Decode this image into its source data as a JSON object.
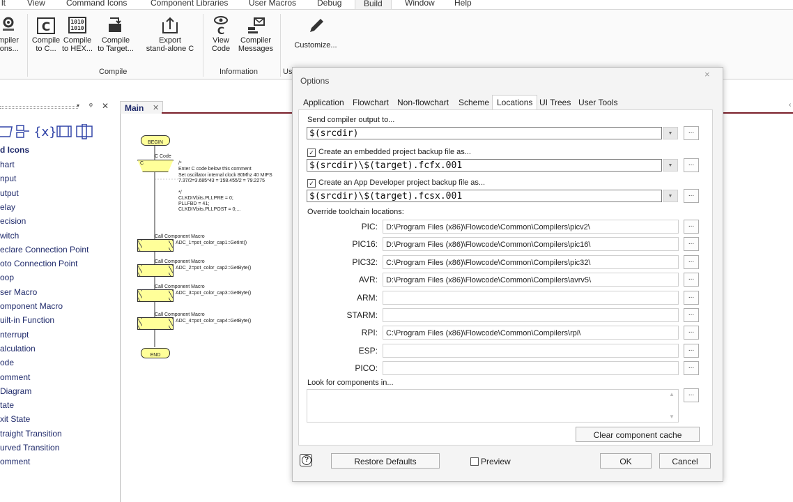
{
  "menu": [
    "lt",
    "View",
    "Command Icons",
    "Component Libraries",
    "User Macros",
    "Debug",
    "Build",
    "Window",
    "Help"
  ],
  "ribbon": {
    "buttons": [
      {
        "line1": "mpiler",
        "line2": "ions..."
      },
      {
        "line1": "Compile",
        "line2": "to C..."
      },
      {
        "line1": "Compile",
        "line2": "to HEX..."
      },
      {
        "line1": "Compile",
        "line2": "to Target..."
      },
      {
        "line1": "Export",
        "line2": "stand-alone C"
      },
      {
        "line1": "View",
        "line2": "Code"
      },
      {
        "line1": "Compiler",
        "line2": "Messages"
      },
      {
        "line1": "Customize...",
        "line2": ""
      }
    ],
    "icon_labels": {
      "c": "C",
      "hex1": "1010",
      "hex2": "1010"
    },
    "groups": [
      "Compile",
      "Information",
      "Us"
    ]
  },
  "left_panel": {
    "controls": {
      "pin": "▾",
      "pin2": "ᵠ",
      "close": "✕"
    },
    "title": "d Icons",
    "items": [
      "hart",
      "nput",
      "utput",
      "elay",
      "ecision",
      "witch",
      "eclare Connection Point",
      "oto Connection Point",
      "oop",
      "ser Macro",
      "omponent Macro",
      "uilt-in Function",
      "nterrupt",
      "alculation",
      "ode",
      "omment",
      "Diagram",
      "tate",
      "xit State",
      "traight Transition",
      "urved Transition",
      "omment"
    ]
  },
  "tab": {
    "label": "Main",
    "close": "✕"
  },
  "flowchart": {
    "begin": "BEGIN",
    "end": "END",
    "ccode_title": "C Code",
    "ccode_letter": "C",
    "ccode_lines": [
      "/*",
      "  Enter C code below this comment",
      "Set oscillator internal clock 80Mhz 40 MIPS",
      "7.37/2=3.685*43 = 158.455/2 = 79.2275",
      "",
      "*/",
      "CLKDIVbits.PLLPRE = 0;",
      "PLLFBD = 41;",
      "CLKDIVbits.PLLPOST = 0;..."
    ],
    "macros": [
      {
        "title": "Call Component Macro",
        "text": "ADC_1=pot_color_cap1::GetInt()"
      },
      {
        "title": "Call Component Macro",
        "text": "ADC_2=pot_color_cap2::GetByte()"
      },
      {
        "title": "Call Component Macro",
        "text": "ADC_3=pot_color_cap3::GetByte()"
      },
      {
        "title": "Call Component Macro",
        "text": "ADC_4=pot_color_cap4::GetByte()"
      }
    ]
  },
  "dialog": {
    "title": "Options",
    "close": "×",
    "tabs": [
      "Application",
      "Flowchart",
      "Non-flowchart",
      "Scheme",
      "Locations",
      "UI Trees",
      "User Tools"
    ],
    "active_tab": "Locations",
    "send_output_label": "Send compiler output to...",
    "send_output_value": "$(srcdir)",
    "embedded_backup_label": "Create an embedded project backup file as...",
    "embedded_backup_value": "$(srcdir)\\$(target).fcfx.001",
    "appdev_backup_label": "Create an App Developer project backup file as...",
    "appdev_backup_value": "$(srcdir)\\$(target).fcsx.001",
    "override_label": "Override toolchain locations:",
    "toolchains": [
      {
        "name": "PIC:",
        "path": "D:\\Program Files (x86)\\Flowcode\\Common\\Compilers\\picv2\\"
      },
      {
        "name": "PIC16:",
        "path": "D:\\Program Files (x86)\\Flowcode\\Common\\Compilers\\pic16\\"
      },
      {
        "name": "PIC32:",
        "path": "C:\\Program Files (x86)\\Flowcode\\Common\\Compilers\\pic32\\"
      },
      {
        "name": "AVR:",
        "path": "D:\\Program Files (x86)\\Flowcode\\Common\\Compilers\\avrv5\\"
      },
      {
        "name": "ARM:",
        "path": ""
      },
      {
        "name": "STARM:",
        "path": ""
      },
      {
        "name": "RPI:",
        "path": "C:\\Program Files (x86)\\Flowcode\\Common\\Compilers\\rpi\\"
      },
      {
        "name": "ESP:",
        "path": ""
      },
      {
        "name": "PICO:",
        "path": ""
      }
    ],
    "components_label": "Look for components in...",
    "clear_cache": "Clear component cache",
    "dots": "...",
    "check_mark": "✓",
    "dropdown_arrow": "▼",
    "scroll_up": "▲",
    "scroll_down": "▼",
    "help": "?",
    "restore_defaults": "Restore Defaults",
    "preview": "Preview",
    "ok": "OK",
    "cancel": "Cancel"
  }
}
